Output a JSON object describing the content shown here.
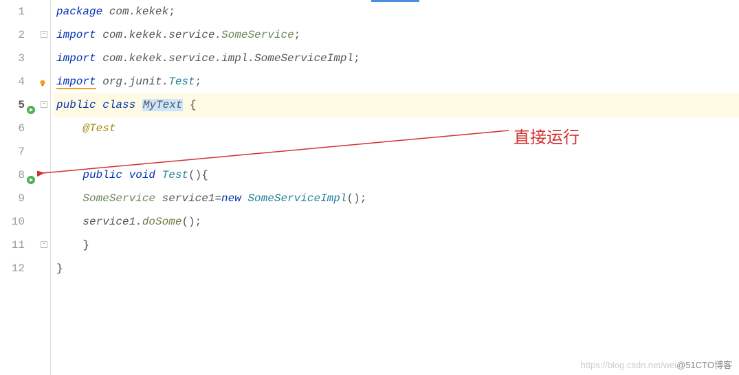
{
  "lines": {
    "1": "1",
    "2": "2",
    "3": "3",
    "4": "4",
    "5": "5",
    "6": "6",
    "7": "7",
    "8": "8",
    "9": "9",
    "10": "10",
    "11": "11",
    "12": "12"
  },
  "code": {
    "l1_package": "package",
    "l1_pkg": " com.kekek",
    "l1_semi": ";",
    "l2_import": "import",
    "l2_pkg": " com.kekek.service.",
    "l2_cls": "SomeService",
    "l2_semi": ";",
    "l3_import": "import",
    "l3_pkg": " com.kekek.service.impl.",
    "l3_cls": "SomeServiceImpl",
    "l3_semi": ";",
    "l4_import": "import",
    "l4_pkg": " org.junit.",
    "l4_cls": "Test",
    "l4_semi": ";",
    "l5_public": "public",
    "l5_class": " class ",
    "l5_name": "MyText",
    "l5_brace": " {",
    "l6_anno": "@Test",
    "l8_public": "public",
    "l8_void": " void ",
    "l8_method": "Test",
    "l8_paren": "(){",
    "l9_type": "SomeService",
    "l9_var": " service1=",
    "l9_new": "new ",
    "l9_impl": "SomeServiceImpl",
    "l9_paren": "();",
    "l10_call": "service1.doSome();",
    "l10_var": "service1.",
    "l10_method": "doSome",
    "l10_paren": "();",
    "l11_brace": "}",
    "l12_brace": "}"
  },
  "annotation": {
    "label": "直接运行"
  },
  "watermark": {
    "faded": "https://blog.csdn.net/wei",
    "dark": "@51CTO博客"
  }
}
